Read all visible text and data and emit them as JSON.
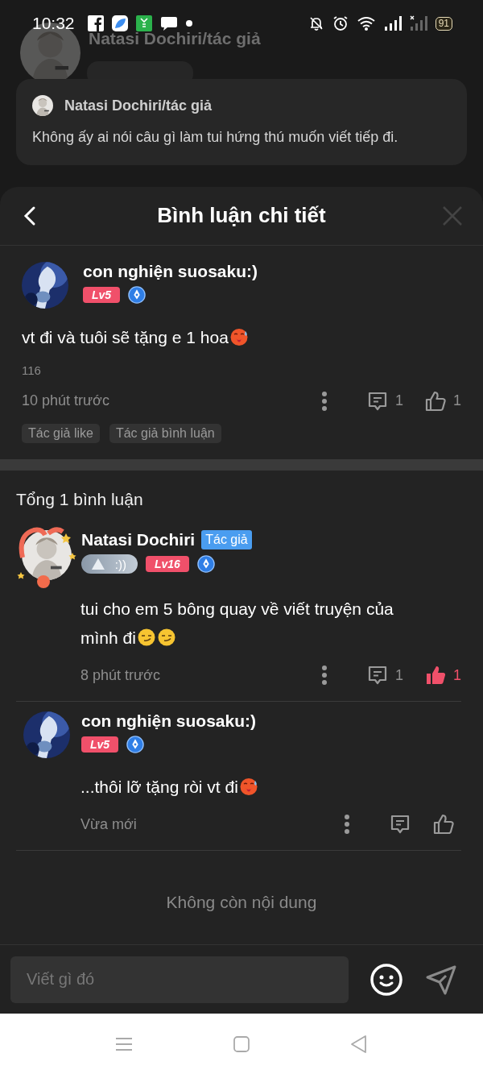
{
  "status_bar": {
    "time": "10:32",
    "battery": "91"
  },
  "background_post": {
    "author": "Natasi Dochiri/tác giả"
  },
  "notification": {
    "author": "Natasi Dochiri/tác giả",
    "message": "Không ấy ai nói câu gì làm tui hứng thú muốn viết tiếp đi."
  },
  "sheet": {
    "title": "Bình luận chi tiết"
  },
  "comment": {
    "author": "con nghiện suosaku:)",
    "badges": [
      {
        "kind": "level",
        "label": "Lv5"
      },
      {
        "kind": "pen"
      }
    ],
    "lines": [
      "vt đi và tuôi sẽ tặng e 1 hoa"
    ],
    "emojis": [
      {
        "kind": "hot_face"
      }
    ],
    "note": "116",
    "time": "10 phút trước",
    "comment_count": "1",
    "like_count": "1",
    "liked": false,
    "tags": [
      "Tác giả like",
      "Tác giả bình luận"
    ]
  },
  "replies": {
    "title": "Tổng 1 bình luận",
    "items": [
      {
        "author": "Natasi Dochiri",
        "author_tag": "Tác giả",
        "avatar_frame": true,
        "badges": [
          {
            "kind": "medal",
            "label": ":))"
          },
          {
            "kind": "level",
            "label": "Lv16"
          },
          {
            "kind": "pen"
          }
        ],
        "lines": [
          "tui cho em 5 bông quay về viết truyện của",
          "mình đi"
        ],
        "emojis": [
          {
            "kind": "smirk"
          },
          {
            "kind": "smirk"
          }
        ],
        "time": "8 phút trước",
        "comment_count": "1",
        "like_count": "1",
        "liked": true
      },
      {
        "author": "con nghiện suosaku:)",
        "avatar_frame": false,
        "badges": [
          {
            "kind": "level",
            "label": "Lv5"
          },
          {
            "kind": "pen"
          }
        ],
        "lines": [
          "...thôi lỡ tặng ròi vt đi"
        ],
        "emojis": [
          {
            "kind": "hot_face"
          }
        ],
        "time": "Vừa mới",
        "liked": false
      }
    ]
  },
  "end_note": "Không còn nội dung",
  "composer": {
    "placeholder": "Viết gì đó"
  }
}
